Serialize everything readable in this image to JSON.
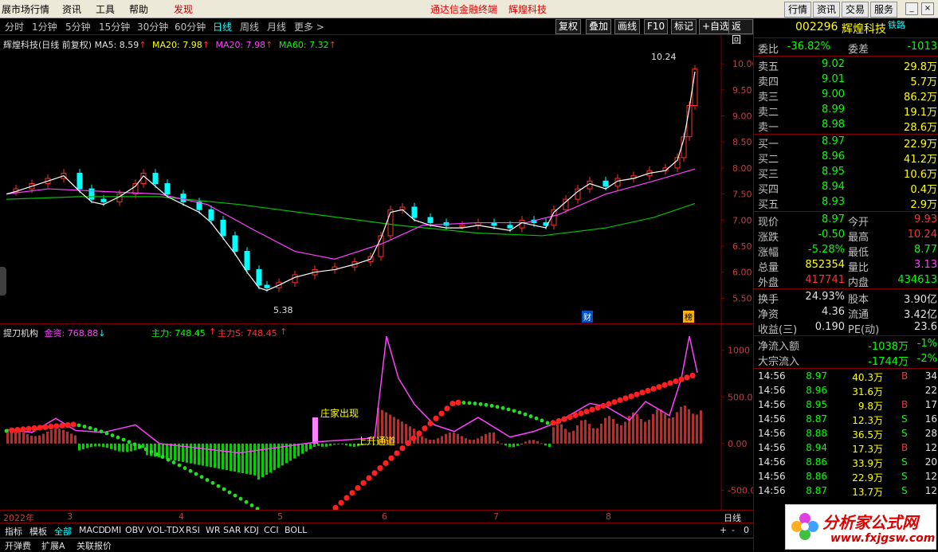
{
  "menubar": {
    "items": [
      "展市场行情",
      "资讯",
      "工具",
      "帮助",
      "发现"
    ],
    "center_left": "通达信金融终端",
    "center_right": "辉煌科技",
    "right_buttons": [
      "行情",
      "资讯",
      "交易",
      "服务"
    ]
  },
  "periods": {
    "tabs": [
      "分时",
      "1分钟",
      "5分钟",
      "15分钟",
      "30分钟",
      "60分钟",
      "日线",
      "周线",
      "月线",
      "更多 >"
    ],
    "active": "日线"
  },
  "toolbar": {
    "buttons": [
      "复权",
      "叠加",
      "画线",
      "F10",
      "标记",
      "+自选",
      "返回"
    ]
  },
  "main_legend": {
    "title": "辉煌科技(日线 前复权)",
    "ma5": "MA5: 8.59",
    "ma20a": "MA20: 7.98",
    "ma20b": "MA20: 7.98",
    "ma60": "MA60: 7.32"
  },
  "main_axis": {
    "ticks": [
      "10.00",
      "9.50",
      "9.00",
      "8.50",
      "8.00",
      "7.50",
      "7.00",
      "6.50",
      "6.00",
      "5.50"
    ],
    "high_label": "10.24",
    "low_label": "5.38",
    "badge_cai": "财",
    "badge_bang": "榜"
  },
  "sub_legend": {
    "title": "提刀机构",
    "jinzi": "金资: 768.88",
    "zhuli": "主力: 748.45",
    "zhulis": "主力S: 748.45"
  },
  "sub_axis": {
    "ticks": [
      "1000",
      "500.0",
      "0.00",
      "-500.0"
    ]
  },
  "annotations": {
    "zhuangjia": "庄家出现",
    "shangsheng": "上升通道"
  },
  "date_axis": {
    "labels": [
      "2022年",
      "3",
      "4",
      "5",
      "6",
      "7",
      "8"
    ],
    "period_label": "日线"
  },
  "bottom_tabs": {
    "items": [
      "指标",
      "模板",
      "全部",
      "MACD",
      "DMI",
      "OBV",
      "VOL-TDX",
      "RSI",
      "WR",
      "SAR",
      "KDJ",
      "CCI",
      "BOLL"
    ],
    "active": "全部",
    "row2": [
      "开弹费",
      "扩展A",
      "关联报价"
    ],
    "zoom": [
      "+",
      "-",
      "0"
    ]
  },
  "quote": {
    "code": "002296",
    "name": "辉煌科技",
    "tag": "铁路",
    "weibi_label": "委比",
    "weibi": "-36.82%",
    "weicha_label": "委差",
    "weicha": "-1013",
    "sell": [
      {
        "label": "卖五",
        "price": "9.02",
        "vol": "29.8万"
      },
      {
        "label": "卖四",
        "price": "9.01",
        "vol": "5.7万"
      },
      {
        "label": "卖三",
        "price": "9.00",
        "vol": "86.2万"
      },
      {
        "label": "卖二",
        "price": "8.99",
        "vol": "19.1万"
      },
      {
        "label": "卖一",
        "price": "8.98",
        "vol": "28.6万"
      }
    ],
    "buy": [
      {
        "label": "买一",
        "price": "8.97",
        "vol": "22.9万"
      },
      {
        "label": "买二",
        "price": "8.96",
        "vol": "41.2万"
      },
      {
        "label": "买三",
        "price": "8.95",
        "vol": "10.6万"
      },
      {
        "label": "买四",
        "price": "8.94",
        "vol": "0.4万"
      },
      {
        "label": "买五",
        "price": "8.93",
        "vol": "2.9万"
      }
    ],
    "stats": [
      {
        "l1": "现价",
        "v1": "8.97",
        "c1": "green",
        "l2": "今开",
        "v2": "9.93",
        "c2": "red"
      },
      {
        "l1": "涨跌",
        "v1": "-0.50",
        "c1": "green",
        "l2": "最高",
        "v2": "10.24",
        "c2": "red"
      },
      {
        "l1": "涨幅",
        "v1": "-5.28%",
        "c1": "green",
        "l2": "最低",
        "v2": "8.77",
        "c2": "green"
      },
      {
        "l1": "总量",
        "v1": "852354",
        "c1": "yellow",
        "l2": "量比",
        "v2": "3.13",
        "c2": "magenta"
      },
      {
        "l1": "外盘",
        "v1": "417741",
        "c1": "red",
        "l2": "内盘",
        "v2": "434613",
        "c2": "green"
      }
    ],
    "stats2": [
      {
        "l1": "换手",
        "v1": "24.93%",
        "l2": "股本",
        "v2": "3.90亿"
      },
      {
        "l1": "净资",
        "v1": "4.36",
        "l2": "流通",
        "v2": "3.42亿"
      },
      {
        "l1": "收益(三)",
        "v1": "0.190",
        "l2": "PE(动)",
        "v2": "23.6"
      }
    ],
    "flow": [
      {
        "label": "净流入额",
        "value": "-1038万",
        "pct": "-1%"
      },
      {
        "label": "大宗流入",
        "value": "-1744万",
        "pct": "-2%"
      }
    ],
    "ticks": [
      {
        "time": "14:56",
        "price": "8.97",
        "vol": "40.3万",
        "side": "B",
        "n": "34"
      },
      {
        "time": "14:56",
        "price": "8.96",
        "vol": "31.6万",
        "side": "",
        "n": "22"
      },
      {
        "time": "14:56",
        "price": "8.95",
        "vol": "9.8万",
        "side": "B",
        "n": "17"
      },
      {
        "time": "14:56",
        "price": "8.87",
        "vol": "12.3万",
        "side": "S",
        "n": "16"
      },
      {
        "time": "14:56",
        "price": "8.88",
        "vol": "36.5万",
        "side": "S",
        "n": "28"
      },
      {
        "time": "14:56",
        "price": "8.94",
        "vol": "17.3万",
        "side": "B",
        "n": "12"
      },
      {
        "time": "14:56",
        "price": "8.86",
        "vol": "33.9万",
        "side": "S",
        "n": "20"
      },
      {
        "time": "14:56",
        "price": "8.86",
        "vol": "22.9万",
        "side": "S",
        "n": "12"
      },
      {
        "time": "14:56",
        "price": "8.87",
        "vol": "13.7万",
        "side": "S",
        "n": "12"
      }
    ]
  },
  "watermark": {
    "cn": "分析家公式网",
    "url": "www.fxjgsw.com"
  },
  "colors": {
    "bg": "#000000",
    "up": "#ff3030",
    "down": "#00ffff",
    "ma5": "#ffffff",
    "ma20": "#ff40ff",
    "ma60": "#00c000"
  }
}
